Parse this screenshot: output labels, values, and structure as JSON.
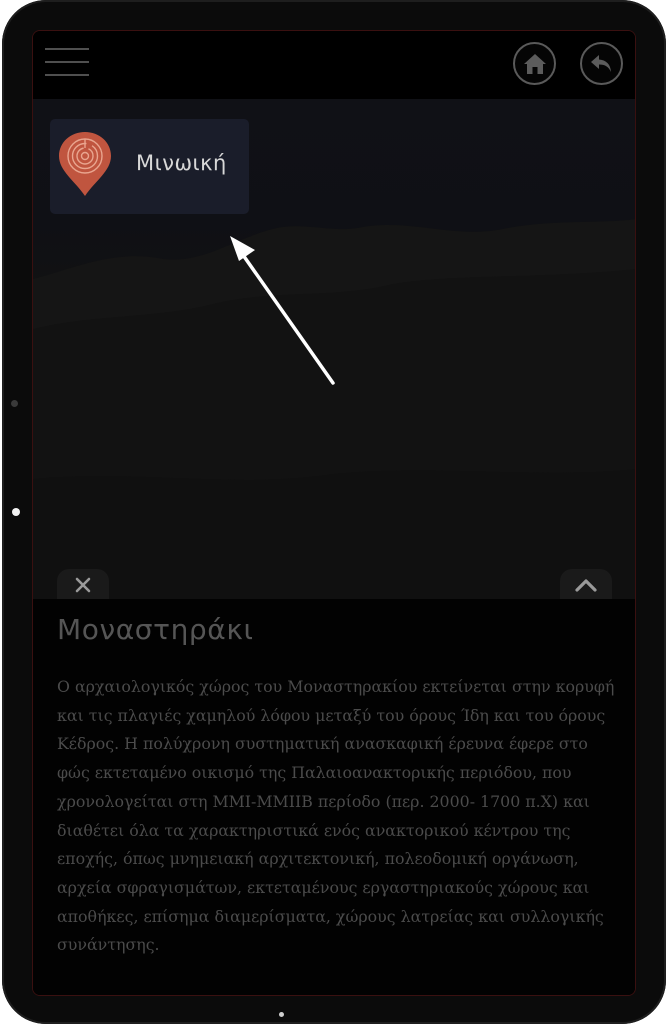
{
  "header": {
    "menu_icon": "hamburger-menu-icon",
    "home_icon": "home-icon",
    "back_icon": "back-arrow-icon"
  },
  "map": {
    "badge_label": "Μινωική",
    "badge_icon": "labyrinth-pin-icon",
    "pin_color": "#c0553f",
    "badge_bg": "#1a1d2a"
  },
  "panel": {
    "close_icon": "close-icon",
    "expand_icon": "chevron-up-icon",
    "title": "Μοναστηράκι",
    "description": "Ο αρχαιολογικός χώρος του Μοναστηρακίου εκτείνεται στην κορυφή και τις πλαγιές χαμηλού λόφου μεταξύ του όρους Ίδη και του όρους Κέδρος. Η πολύχρονη συστηματική ανασκαφική έρευνα έφερε στο φώς εκτεταμένο οικισμό της Παλαιοανακτορικής περιόδου, που χρονολογείται στη ΜΜΙ-ΜΜΙΙΒ περίοδο (περ. 2000- 1700 π.Χ) και διαθέτει όλα τα χαρακτηριστικά ενός ανακτορικού κέντρου της εποχής, όπως μνημειακή αρχιτεκτονική, πολεοδομική οργάνωση, αρχεία σφραγισμάτων, εκτεταμένους εργαστηριακούς χώρους και αποθήκες, επίσημα διαμερίσματα, χώρους λατρείας και συλλογικής συνάντησης."
  }
}
